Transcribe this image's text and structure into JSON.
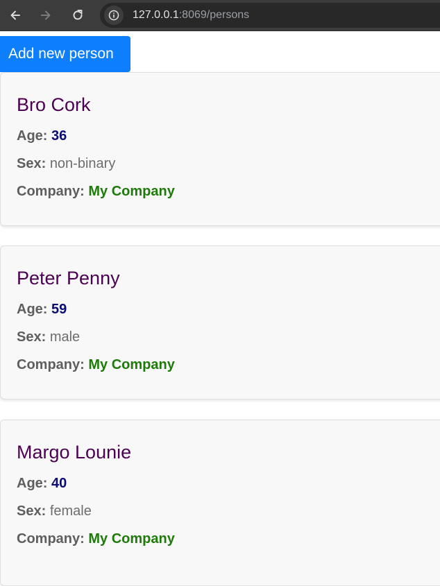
{
  "browser": {
    "url_host": "127.0.0.1",
    "url_rest": ":8069/persons",
    "icons": {
      "back": "arrow-left-icon",
      "forward": "arrow-right-icon",
      "reload": "reload-icon",
      "site_info": "info-icon"
    }
  },
  "toolbar": {
    "add_label": "Add new person"
  },
  "labels": {
    "age": "Age:",
    "sex": "Sex:",
    "company": "Company:"
  },
  "persons": [
    {
      "name": "Bro Cork",
      "age": "36",
      "sex": "non-binary",
      "company": "My Company"
    },
    {
      "name": "Peter Penny",
      "age": "59",
      "sex": "male",
      "company": "My Company"
    },
    {
      "name": "Margo Lounie",
      "age": "40",
      "sex": "female",
      "company": "My Company"
    }
  ],
  "colors": {
    "accent": "#0d7efc",
    "name": "#4b0051",
    "age_value": "#0b0b73",
    "company_value": "#1e7a0a"
  }
}
